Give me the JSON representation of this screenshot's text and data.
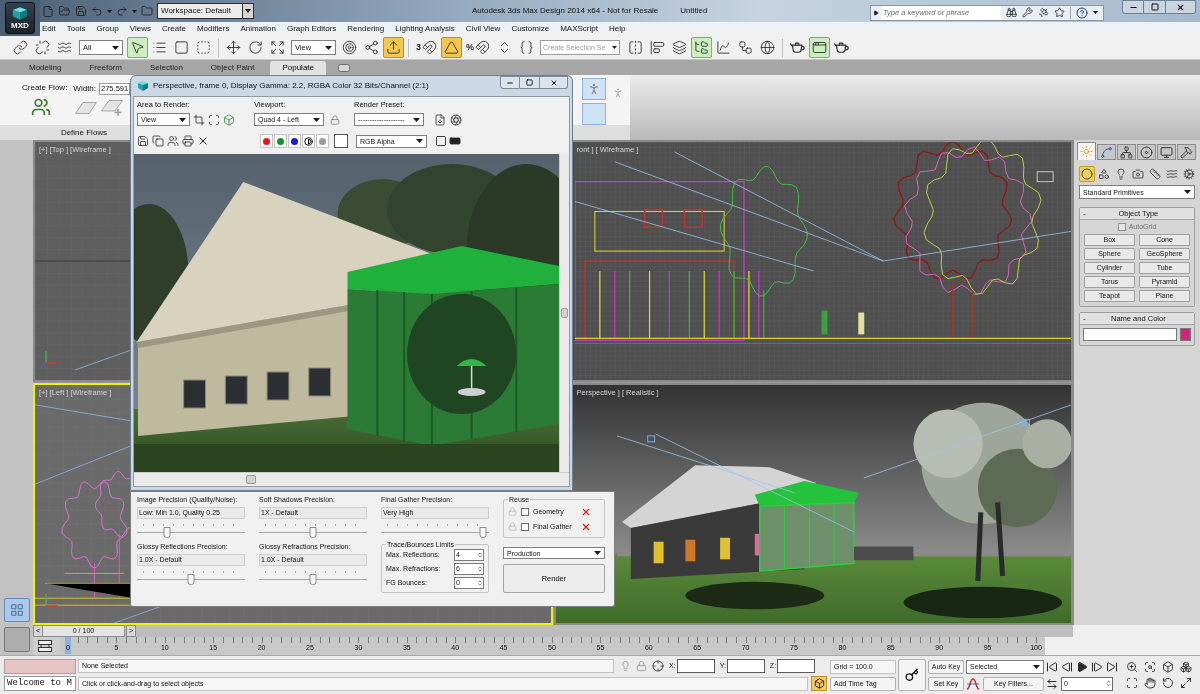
{
  "title_bar": {
    "app_button": "MXD",
    "workspace": "Workspace: Default",
    "title": "Autodesk 3ds Max Design 2014 x64 - Not for Resale",
    "document": "Untitled",
    "search": {
      "placeholder": "Type a keyword or phrase"
    }
  },
  "menu": [
    "Edit",
    "Tools",
    "Group",
    "Views",
    "Create",
    "Modifiers",
    "Animation",
    "Graph Editors",
    "Rendering",
    "Lighting Analysis",
    "Civil View",
    "Customize",
    "MAXScript",
    "Help"
  ],
  "main_toolbar": {
    "link_tools": [
      {
        "on": false
      },
      {
        "on": false
      },
      {
        "on": false
      }
    ],
    "selection_filter": "All",
    "selection_tools": [
      {
        "on": true
      },
      {
        "on": false
      },
      {
        "on": false
      },
      {
        "on": false
      }
    ],
    "transform_tools": [
      {
        "on": false
      },
      {
        "on": false
      },
      {
        "on": false
      }
    ],
    "reference_coordinate_system": "View",
    "pivot_tools": [
      {
        "on": false
      },
      {
        "on": false
      },
      {
        "on": true
      }
    ],
    "snap_tools": [
      {
        "label": "3",
        "on": false
      },
      {
        "on": true
      },
      {
        "label": "%",
        "on": false
      },
      {
        "on": false
      },
      {
        "on": false
      }
    ],
    "named_selection": {
      "placeholder": "Create Selection Se"
    },
    "scene_tools": [
      {
        "on": false
      },
      {
        "on": false
      },
      {
        "on": false
      },
      {
        "on": true
      },
      {
        "on": false
      },
      {
        "on": false
      },
      {
        "on": false
      }
    ],
    "render_tools": [
      {
        "on": false
      },
      {
        "on": true
      },
      {
        "on": false
      }
    ]
  },
  "ribbon": {
    "tabs": [
      {
        "label": "Modeling",
        "selected": false
      },
      {
        "label": "Freeform",
        "selected": false
      },
      {
        "label": "Selection",
        "selected": false
      },
      {
        "label": "Object Paint",
        "selected": false
      },
      {
        "label": "Populate",
        "selected": true
      }
    ],
    "panel": {
      "create_flow": "Create Flow:",
      "width_label": "Width:",
      "width_value": "275.591",
      "title": "Define Flows"
    }
  },
  "viewports": [
    {
      "kind": "top",
      "label": "[+] [Top ] [Wireframe ]",
      "active": false
    },
    {
      "kind": "front",
      "label": "ront ] [ Wireframe ]",
      "active": false
    },
    {
      "kind": "left",
      "label": "[+] [Left ] [Wireframe ]",
      "active": true
    },
    {
      "kind": "perspective",
      "label": "Perspective ] [ Realistic ]",
      "active": false
    }
  ],
  "command_panel": {
    "tabs": [
      {
        "selected": true
      },
      {
        "selected": false
      },
      {
        "selected": false
      },
      {
        "selected": false
      },
      {
        "selected": false
      },
      {
        "selected": false
      }
    ],
    "categories": [
      {
        "selected": true
      },
      {
        "selected": false
      },
      {
        "selected": false
      },
      {
        "selected": false
      },
      {
        "selected": false
      },
      {
        "selected": false
      },
      {
        "selected": false
      }
    ],
    "object_category": "Standard Primitives",
    "object_type": {
      "collapse": "-",
      "title": "Object Type",
      "autogrid": {
        "label": "AutoGrid",
        "checked": false,
        "disabled": true
      },
      "buttons": [
        "Box",
        "Cone",
        "Sphere",
        "GeoSphere",
        "Cylinder",
        "Tube",
        "Torus",
        "Pyramid",
        "Teapot",
        "Plane"
      ]
    },
    "name_and_color": {
      "collapse": "-",
      "title": "Name and Color",
      "color": "#d4237f"
    }
  },
  "time_slider": {
    "prev": "<",
    "position": "0 / 100",
    "next": ">"
  },
  "track_bar": {
    "frames": [
      "0",
      "5",
      "10",
      "15",
      "20",
      "25",
      "30",
      "35",
      "40",
      "45",
      "50",
      "55",
      "60",
      "65",
      "70",
      "75",
      "80",
      "85",
      "90",
      "95",
      "100"
    ]
  },
  "status_bar": {
    "listener": "Welcome to M",
    "selection": "None Selected",
    "prompt": "Click or click-and-drag to select objects",
    "coordinates": [
      "X:",
      "Y:",
      "Z:"
    ],
    "grid": "Grid = 100.0",
    "time_tag": "Add Time Tag",
    "auto_key": "Auto Key",
    "set_key": "Set Key",
    "key_mode": "Selected",
    "key_filters": "Key Filters...",
    "frame": "0"
  },
  "render_window": {
    "title": "Perspective, frame 0, Display Gamma: 2.2, RGBA Color 32 Bits/Channel (2:1)",
    "area_to_render": {
      "label": "Area to Render:",
      "value": "View"
    },
    "viewport": {
      "label": "Viewport:",
      "value": "Quad 4 - Left"
    },
    "render_preset": {
      "label": "Render Preset:",
      "value": "--------------------"
    },
    "channels": [
      {
        "kind": "color",
        "color": "#e8141b"
      },
      {
        "kind": "color",
        "color": "#12922d"
      },
      {
        "kind": "color",
        "color": "#1a1ad8"
      },
      {
        "kind": "mono"
      },
      {
        "kind": "alpha"
      }
    ],
    "display_channel": "RGB Alpha",
    "settings": {
      "sliders": [
        {
          "label": "Image Precision (Quality/Noise):",
          "value": "Low: Min 1.0, Quality 0.25",
          "level": 0.25
        },
        {
          "label": "Soft Shadows Precision:",
          "value": "1X - Default",
          "level": 0.5
        },
        {
          "label": "Final Gather Precision:",
          "value": "Very High",
          "level": 1
        },
        {
          "label": "Glossy Reflections Precision:",
          "value": "1.0X - Default",
          "level": 0.5
        },
        {
          "label": "Glossy Refractions Precision:",
          "value": "1.0X - Default",
          "level": 0.5
        }
      ],
      "trace": {
        "title": "Trace/Bounces Limits",
        "fields": [
          {
            "label": "Max. Reflections:",
            "value": "4"
          },
          {
            "label": "Max. Refractions:",
            "value": "6"
          },
          {
            "label": "FG Bounces:",
            "value": "0"
          }
        ]
      },
      "reuse": {
        "title": "Reuse",
        "items": [
          {
            "label": "Geometry",
            "checked": false
          },
          {
            "label": "Final Gather",
            "checked": false
          }
        ]
      },
      "preset": "Production",
      "render_button": "Render"
    }
  }
}
